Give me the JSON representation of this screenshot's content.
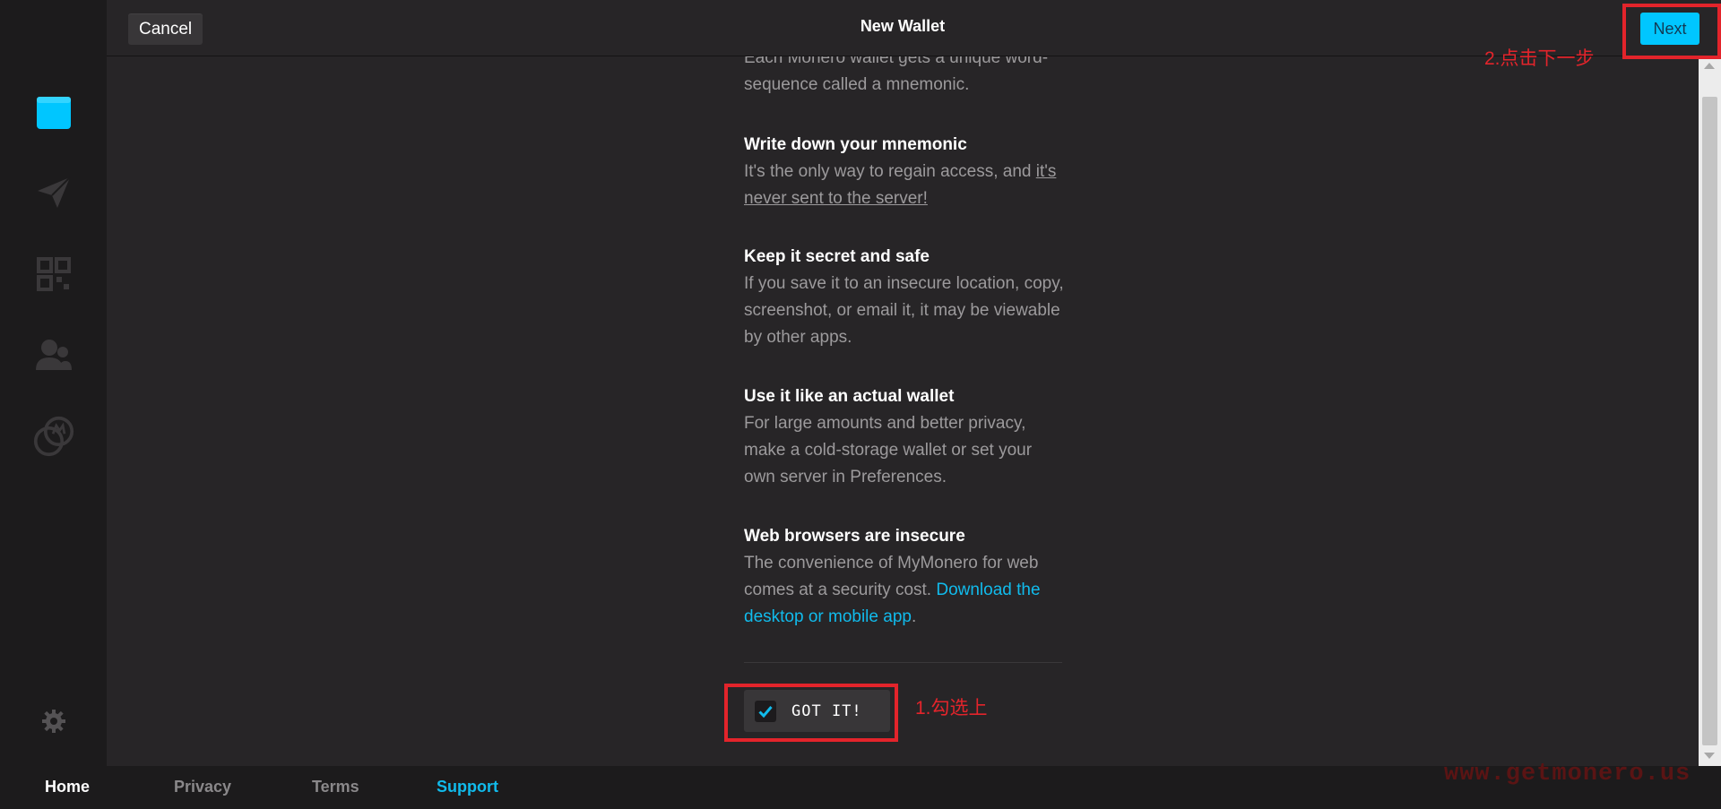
{
  "header": {
    "cancel_label": "Cancel",
    "title": "New Wallet",
    "next_label": "Next"
  },
  "content": {
    "intro_text": "Each Monero wallet gets a unique word-sequence called a mnemonic.",
    "sections": [
      {
        "title": "Write down your mnemonic",
        "text_before": "It's the only way to regain access, and ",
        "link": "it's never sent to the server!",
        "text_after": ""
      },
      {
        "title": "Keep it secret and safe",
        "text": "If you save it to an insecure location, copy, screenshot, or email it, it may be viewable by other apps."
      },
      {
        "title": "Use it like an actual wallet",
        "text": "For large amounts and better privacy, make a cold-storage wallet or set your own server in Preferences."
      },
      {
        "title": "Web browsers are insecure",
        "text_before": "The convenience of MyMonero for web comes at a security cost. ",
        "link": "Download the desktop or mobile app",
        "text_after": "."
      }
    ],
    "got_it_label": "GOT IT!",
    "got_it_checked": true
  },
  "annotations": {
    "step1": "1.勾选上",
    "step2": "2.点击下一步",
    "watermark": "www.getmonero.us"
  },
  "sidebar": {
    "items": [
      "wallet-icon",
      "send-icon",
      "qr-code-icon",
      "contacts-icon",
      "exchange-icon",
      "settings-icon"
    ]
  },
  "footer": {
    "links": [
      {
        "label": "Home",
        "active": true
      },
      {
        "label": "Privacy",
        "active": false
      },
      {
        "label": "Terms",
        "active": false
      },
      {
        "label": "Support",
        "active": false
      }
    ]
  },
  "colors": {
    "accent": "#00c6ff",
    "link": "#11bbec",
    "annotation_red": "#e3242b",
    "background": "#272527",
    "sidebar": "#1c1b1c"
  }
}
